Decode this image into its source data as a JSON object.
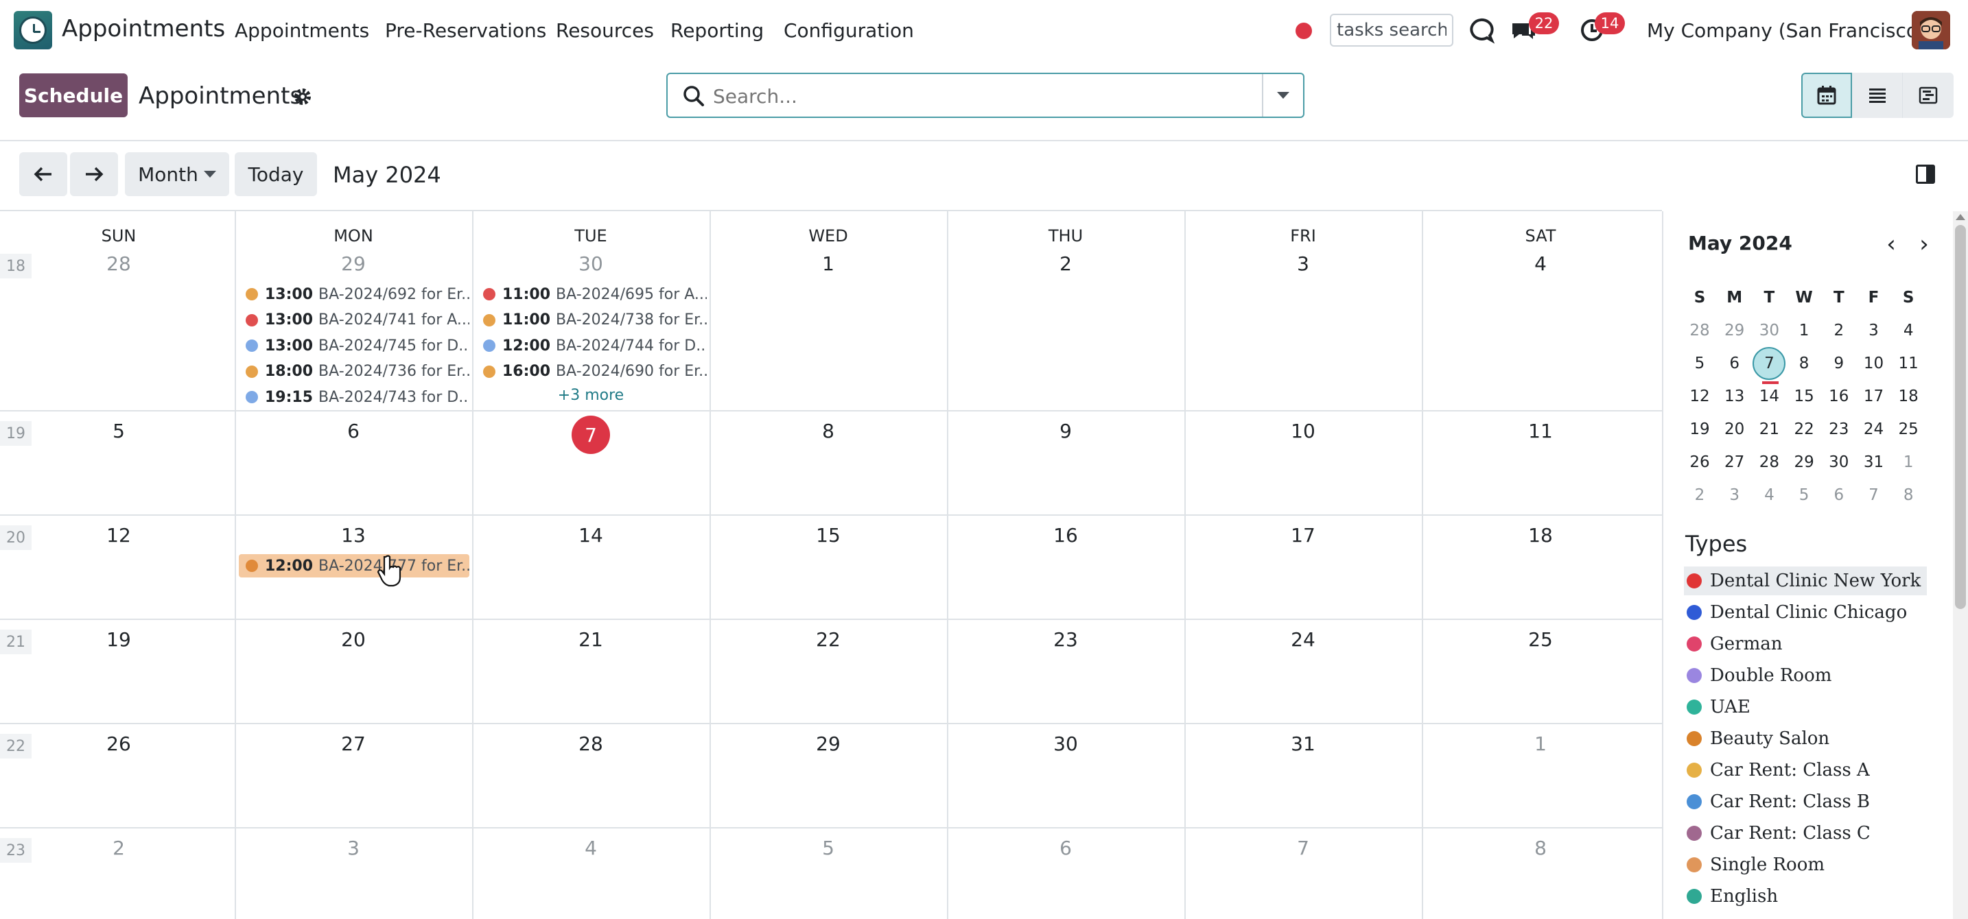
{
  "nav": {
    "app_name": "Appointments",
    "menu": [
      "Appointments",
      "Pre-Reservations",
      "Resources",
      "Reporting",
      "Configuration"
    ],
    "tasks_search_value": "tasks search",
    "messages_badge": "22",
    "activities_badge": "14",
    "company": "My Company (San Francisco)",
    "icons": [
      "appointment-clock-icon",
      "record-dot-icon",
      "discuss-icon",
      "chat-icon",
      "clock-icon",
      "user-avatar"
    ]
  },
  "control": {
    "schedule_label": "Schedule",
    "title": "Appointments",
    "search_placeholder": "Search..."
  },
  "toolbar": {
    "scale_label": "Month",
    "today_label": "Today",
    "period": "May 2024"
  },
  "calendar": {
    "weekdays": [
      "SUN",
      "MON",
      "TUE",
      "WED",
      "THU",
      "FRI",
      "SAT"
    ],
    "weeks": [
      {
        "num": "18",
        "days": [
          "28",
          "29",
          "30",
          "1",
          "2",
          "3",
          "4"
        ],
        "muted": [
          true,
          true,
          true,
          false,
          false,
          false,
          false
        ]
      },
      {
        "num": "19",
        "days": [
          "5",
          "6",
          "7",
          "8",
          "9",
          "10",
          "11"
        ],
        "muted": [
          false,
          false,
          false,
          false,
          false,
          false,
          false
        ]
      },
      {
        "num": "20",
        "days": [
          "12",
          "13",
          "14",
          "15",
          "16",
          "17",
          "18"
        ],
        "muted": [
          false,
          false,
          false,
          false,
          false,
          false,
          false
        ]
      },
      {
        "num": "21",
        "days": [
          "19",
          "20",
          "21",
          "22",
          "23",
          "24",
          "25"
        ],
        "muted": [
          false,
          false,
          false,
          false,
          false,
          false,
          false
        ]
      },
      {
        "num": "22",
        "days": [
          "26",
          "27",
          "28",
          "29",
          "30",
          "31",
          "1"
        ],
        "muted": [
          false,
          false,
          false,
          false,
          false,
          false,
          true
        ]
      },
      {
        "num": "23",
        "days": [
          "2",
          "3",
          "4",
          "5",
          "6",
          "7",
          "8"
        ],
        "muted": [
          true,
          true,
          true,
          true,
          true,
          true,
          true
        ]
      }
    ],
    "today": "7",
    "events": [
      {
        "week": 0,
        "day": 1,
        "slot": 0,
        "time": "13:00",
        "title": "BA-2024/692 for Er...",
        "color": "#e6a24a"
      },
      {
        "week": 0,
        "day": 1,
        "slot": 1,
        "time": "13:00",
        "title": "BA-2024/741 for A...",
        "color": "#e04f4f"
      },
      {
        "week": 0,
        "day": 1,
        "slot": 2,
        "time": "13:00",
        "title": "BA-2024/745 for D...",
        "color": "#7ea9e6"
      },
      {
        "week": 0,
        "day": 1,
        "slot": 3,
        "time": "18:00",
        "title": "BA-2024/736 for Er...",
        "color": "#e6a24a"
      },
      {
        "week": 0,
        "day": 1,
        "slot": 4,
        "time": "19:15",
        "title": "BA-2024/743 for D...",
        "color": "#7ea9e6"
      },
      {
        "week": 0,
        "day": 2,
        "slot": 0,
        "time": "11:00",
        "title": "BA-2024/695 for A...",
        "color": "#e04f4f"
      },
      {
        "week": 0,
        "day": 2,
        "slot": 1,
        "time": "11:00",
        "title": "BA-2024/738 for Er...",
        "color": "#e6a24a"
      },
      {
        "week": 0,
        "day": 2,
        "slot": 2,
        "time": "12:00",
        "title": "BA-2024/744 for D...",
        "color": "#7ea9e6"
      },
      {
        "week": 0,
        "day": 2,
        "slot": 3,
        "time": "16:00",
        "title": "BA-2024/690 for Er...",
        "color": "#e6a24a"
      },
      {
        "week": 2,
        "day": 1,
        "slot": 0,
        "time": "12:00",
        "title": "BA-2024/777 for Er...",
        "color": "#e08a3a",
        "selected": true
      }
    ],
    "more": {
      "week": 0,
      "day": 2,
      "label": "+3 more"
    }
  },
  "mini": {
    "title": "May 2024",
    "weekdays": [
      "S",
      "M",
      "T",
      "W",
      "T",
      "F",
      "S"
    ],
    "rows": [
      [
        "28",
        "29",
        "30",
        "1",
        "2",
        "3",
        "4"
      ],
      [
        "5",
        "6",
        "7",
        "8",
        "9",
        "10",
        "11"
      ],
      [
        "12",
        "13",
        "14",
        "15",
        "16",
        "17",
        "18"
      ],
      [
        "19",
        "20",
        "21",
        "22",
        "23",
        "24",
        "25"
      ],
      [
        "26",
        "27",
        "28",
        "29",
        "30",
        "31",
        "1"
      ],
      [
        "2",
        "3",
        "4",
        "5",
        "6",
        "7",
        "8"
      ]
    ],
    "today": "7"
  },
  "types": {
    "title": "Types",
    "items": [
      {
        "label": "Dental Clinic New York",
        "color": "#e03535"
      },
      {
        "label": "Dental Clinic Chicago",
        "color": "#2f5bd6"
      },
      {
        "label": "German",
        "color": "#e0436b"
      },
      {
        "label": "Double Room",
        "color": "#9a86e0"
      },
      {
        "label": "UAE",
        "color": "#2fb39a"
      },
      {
        "label": "Beauty Salon",
        "color": "#d9822b"
      },
      {
        "label": "Car Rent: Class A",
        "color": "#e6b045"
      },
      {
        "label": "Car Rent: Class B",
        "color": "#4a8fd6"
      },
      {
        "label": "Car Rent: Class C",
        "color": "#a0688f"
      },
      {
        "label": "Single Room",
        "color": "#e0965a"
      },
      {
        "label": "English",
        "color": "#2fa893"
      }
    ]
  }
}
